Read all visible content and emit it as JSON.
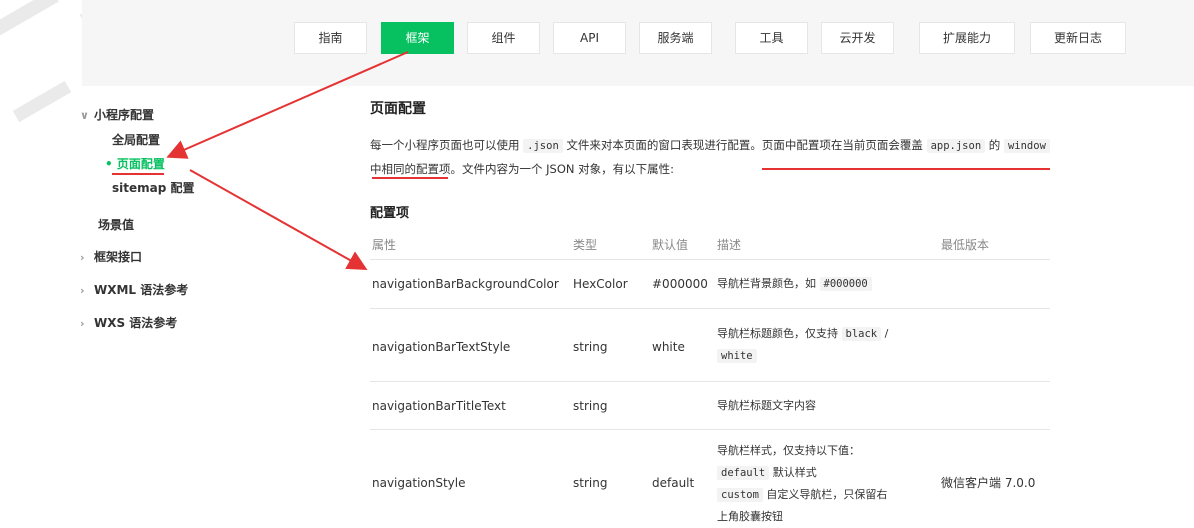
{
  "nav": {
    "items": [
      {
        "label": "指南"
      },
      {
        "label": "框架"
      },
      {
        "label": "组件"
      },
      {
        "label": "API"
      },
      {
        "label": "服务端"
      },
      {
        "label": "工具"
      },
      {
        "label": "云开发"
      },
      {
        "label": "扩展能力"
      },
      {
        "label": "更新日志"
      }
    ],
    "active_color": "#07c160"
  },
  "sidebar": {
    "group": {
      "label": "小程序配置"
    },
    "sub_items": [
      {
        "label": "全局配置"
      },
      {
        "label": "页面配置"
      },
      {
        "label": "sitemap 配置"
      }
    ],
    "items": [
      {
        "label": "场景值"
      },
      {
        "label": "框架接口"
      },
      {
        "label": "WXML 语法参考"
      },
      {
        "label": "WXS 语法参考"
      }
    ]
  },
  "content": {
    "title": "页面配置",
    "para": {
      "p1": "每一个小程序页面也可以使用 ",
      "c1": ".json",
      "p2": " 文件来对本页面的窗口表现进行配置。",
      "p3": "页面中配置项在当前页面会覆盖 ",
      "c2": "app.json",
      "p4": " 的 ",
      "c3": "window",
      "p5": "中相同的配置项",
      "p6": "。文件内容为一个 JSON 对象，有以下属性:"
    },
    "subtitle": "配置项",
    "table": {
      "headers": [
        "属性",
        "类型",
        "默认值",
        "描述",
        "最低版本"
      ],
      "rows": [
        {
          "name": "navigationBarBackgroundColor",
          "type": "HexColor",
          "default": "#000000",
          "desc_text": "导航栏背景颜色，如 ",
          "desc_code": "#000000",
          "version": ""
        },
        {
          "name": "navigationBarTextStyle",
          "type": "string",
          "default": "white",
          "desc_text": "导航栏标题颜色，仅支持 ",
          "desc_code1": "black",
          "desc_sep": " /",
          "desc_code2": "white",
          "version": ""
        },
        {
          "name": "navigationBarTitleText",
          "type": "string",
          "default": "",
          "desc_text": "导航栏标题文字内容",
          "version": ""
        },
        {
          "name": "navigationStyle",
          "type": "string",
          "default": "default",
          "desc_line1": "导航栏样式，仅支持以下值：",
          "desc_code1": "default",
          "desc_line2": " 默认样式",
          "desc_code2": "custom",
          "desc_line3": " 自定义导航栏，只保留右",
          "desc_line4": "上角胶囊按钮",
          "version": "微信客户端 7.0.0"
        }
      ]
    }
  },
  "annotation_color": "#e53333"
}
